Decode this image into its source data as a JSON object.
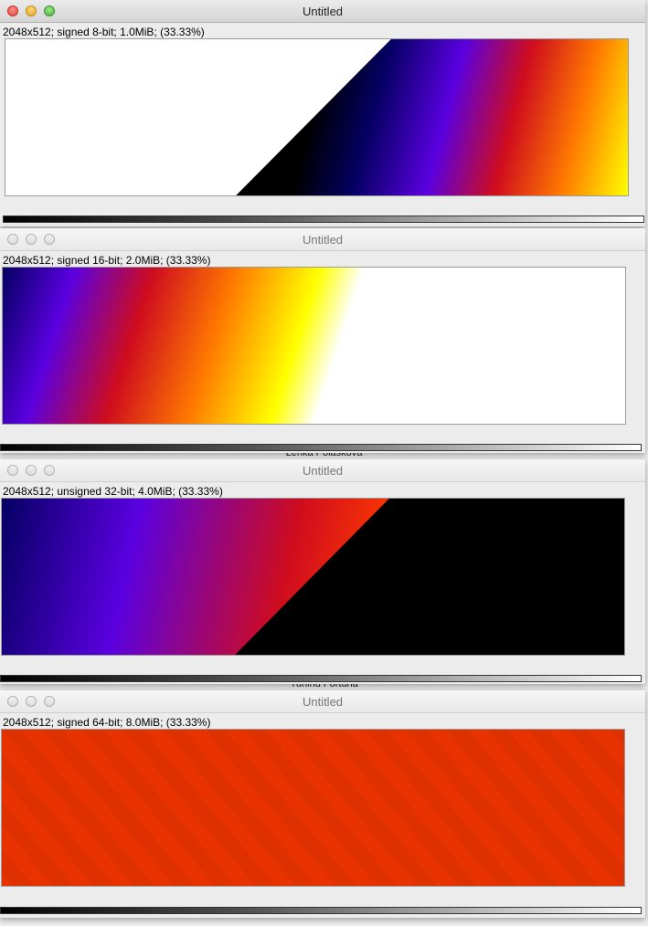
{
  "background_titles": [
    {
      "text": "Lenka Poláskova"
    },
    {
      "text": "Yuning Fortuna"
    }
  ],
  "windows": [
    {
      "title": "Untitled",
      "info": "2048x512; signed 8-bit; 1.0MiB; (33.33%)",
      "active": true
    },
    {
      "title": "Untitled",
      "info": "2048x512; signed 16-bit; 2.0MiB; (33.33%)",
      "active": false
    },
    {
      "title": "Untitled",
      "info": "2048x512; unsigned 32-bit; 4.0MiB; (33.33%)",
      "active": false
    },
    {
      "title": "Untitled",
      "info": "2048x512; signed 64-bit; 8.0MiB; (33.33%)",
      "active": false
    }
  ],
  "colors": {
    "lut_black": "#000000",
    "lut_navy": "#050063",
    "lut_violet": "#5a00e0",
    "lut_red": "#cf0c1e",
    "lut_orange": "#ff7a00",
    "lut_yellow": "#ffff00",
    "flat_64bit": "#e83200"
  },
  "icons": [
    "close-icon",
    "minimize-icon",
    "zoom-icon"
  ]
}
